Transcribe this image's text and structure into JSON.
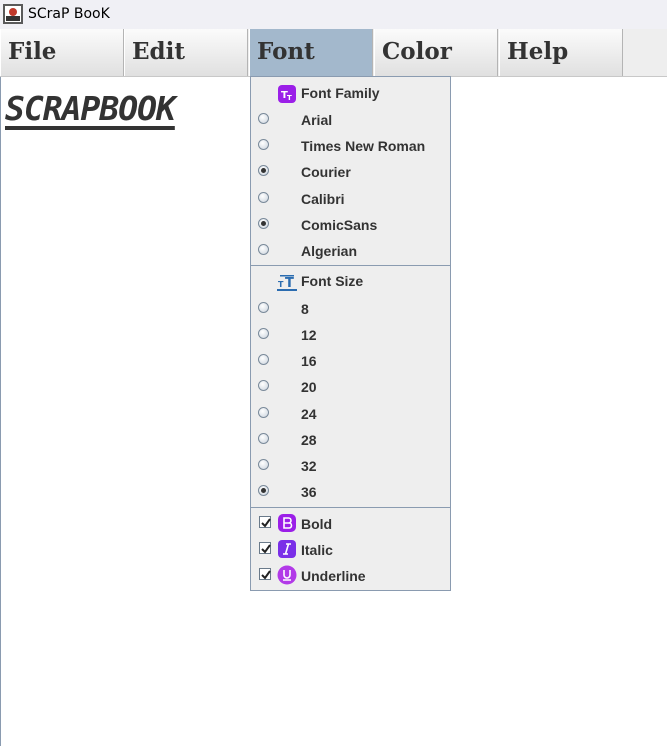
{
  "window": {
    "title": "SCraP BooK",
    "icon": "app-icon"
  },
  "menubar": {
    "items": [
      {
        "label": "File"
      },
      {
        "label": "Edit"
      },
      {
        "label": "Font",
        "active": true
      },
      {
        "label": "Color"
      },
      {
        "label": "Help"
      }
    ]
  },
  "document": {
    "text": "SCRAPBOOK"
  },
  "font_menu": {
    "family_header": {
      "label": "Font Family",
      "icon": "font-family-icon"
    },
    "families": [
      {
        "label": "Arial",
        "selected": false
      },
      {
        "label": "Times New Roman",
        "selected": false
      },
      {
        "label": "Courier",
        "selected": true
      },
      {
        "label": "Calibri",
        "selected": false
      },
      {
        "label": "ComicSans",
        "selected": true
      },
      {
        "label": "Algerian",
        "selected": false
      }
    ],
    "size_header": {
      "label": "Font Size",
      "icon": "font-size-icon"
    },
    "sizes": [
      {
        "label": "8",
        "selected": false
      },
      {
        "label": "12",
        "selected": false
      },
      {
        "label": "16",
        "selected": false
      },
      {
        "label": "20",
        "selected": false
      },
      {
        "label": "24",
        "selected": false
      },
      {
        "label": "28",
        "selected": false
      },
      {
        "label": "32",
        "selected": false
      },
      {
        "label": "36",
        "selected": true
      }
    ],
    "styles": [
      {
        "label": "Bold",
        "checked": true,
        "icon": "bold-icon"
      },
      {
        "label": "Italic",
        "checked": true,
        "icon": "italic-icon"
      },
      {
        "label": "Underline",
        "checked": true,
        "icon": "underline-icon"
      }
    ]
  },
  "colors": {
    "menu_active": "#a3b8cc",
    "icon_purple": "#9b1fe8"
  }
}
